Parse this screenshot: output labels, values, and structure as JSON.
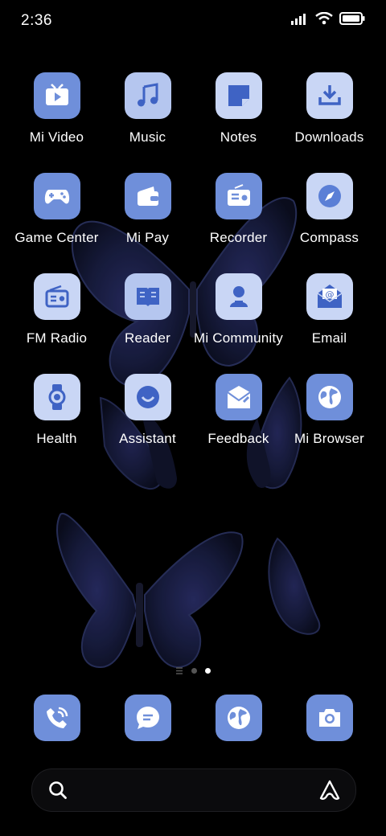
{
  "status": {
    "time": "2:36"
  },
  "apps": [
    {
      "label": "Mi Video",
      "icon": "video-icon"
    },
    {
      "label": "Music",
      "icon": "music-icon"
    },
    {
      "label": "Notes",
      "icon": "notes-icon"
    },
    {
      "label": "Downloads",
      "icon": "download-icon"
    },
    {
      "label": "Game Center",
      "icon": "gamepad-icon"
    },
    {
      "label": "Mi Pay",
      "icon": "wallet-icon"
    },
    {
      "label": "Recorder",
      "icon": "recorder-icon"
    },
    {
      "label": "Compass",
      "icon": "compass-icon"
    },
    {
      "label": "FM Radio",
      "icon": "radio-icon"
    },
    {
      "label": "Reader",
      "icon": "book-icon"
    },
    {
      "label": "Mi Community",
      "icon": "community-icon"
    },
    {
      "label": "Email",
      "icon": "email-icon"
    },
    {
      "label": "Health",
      "icon": "watch-icon"
    },
    {
      "label": "Assistant",
      "icon": "assistant-icon"
    },
    {
      "label": "Feedback",
      "icon": "feedback-icon"
    },
    {
      "label": "Mi Browser",
      "icon": "globe-icon"
    }
  ],
  "dock": [
    {
      "icon": "phone-icon"
    },
    {
      "icon": "message-icon"
    },
    {
      "icon": "browser-icon"
    },
    {
      "icon": "camera-icon"
    }
  ],
  "pages": {
    "count": 2,
    "current": 2
  },
  "colors": {
    "icon_blue": "#6f8fda",
    "icon_light": "#b5c6ef",
    "icon_lighter": "#c9d6f5"
  }
}
